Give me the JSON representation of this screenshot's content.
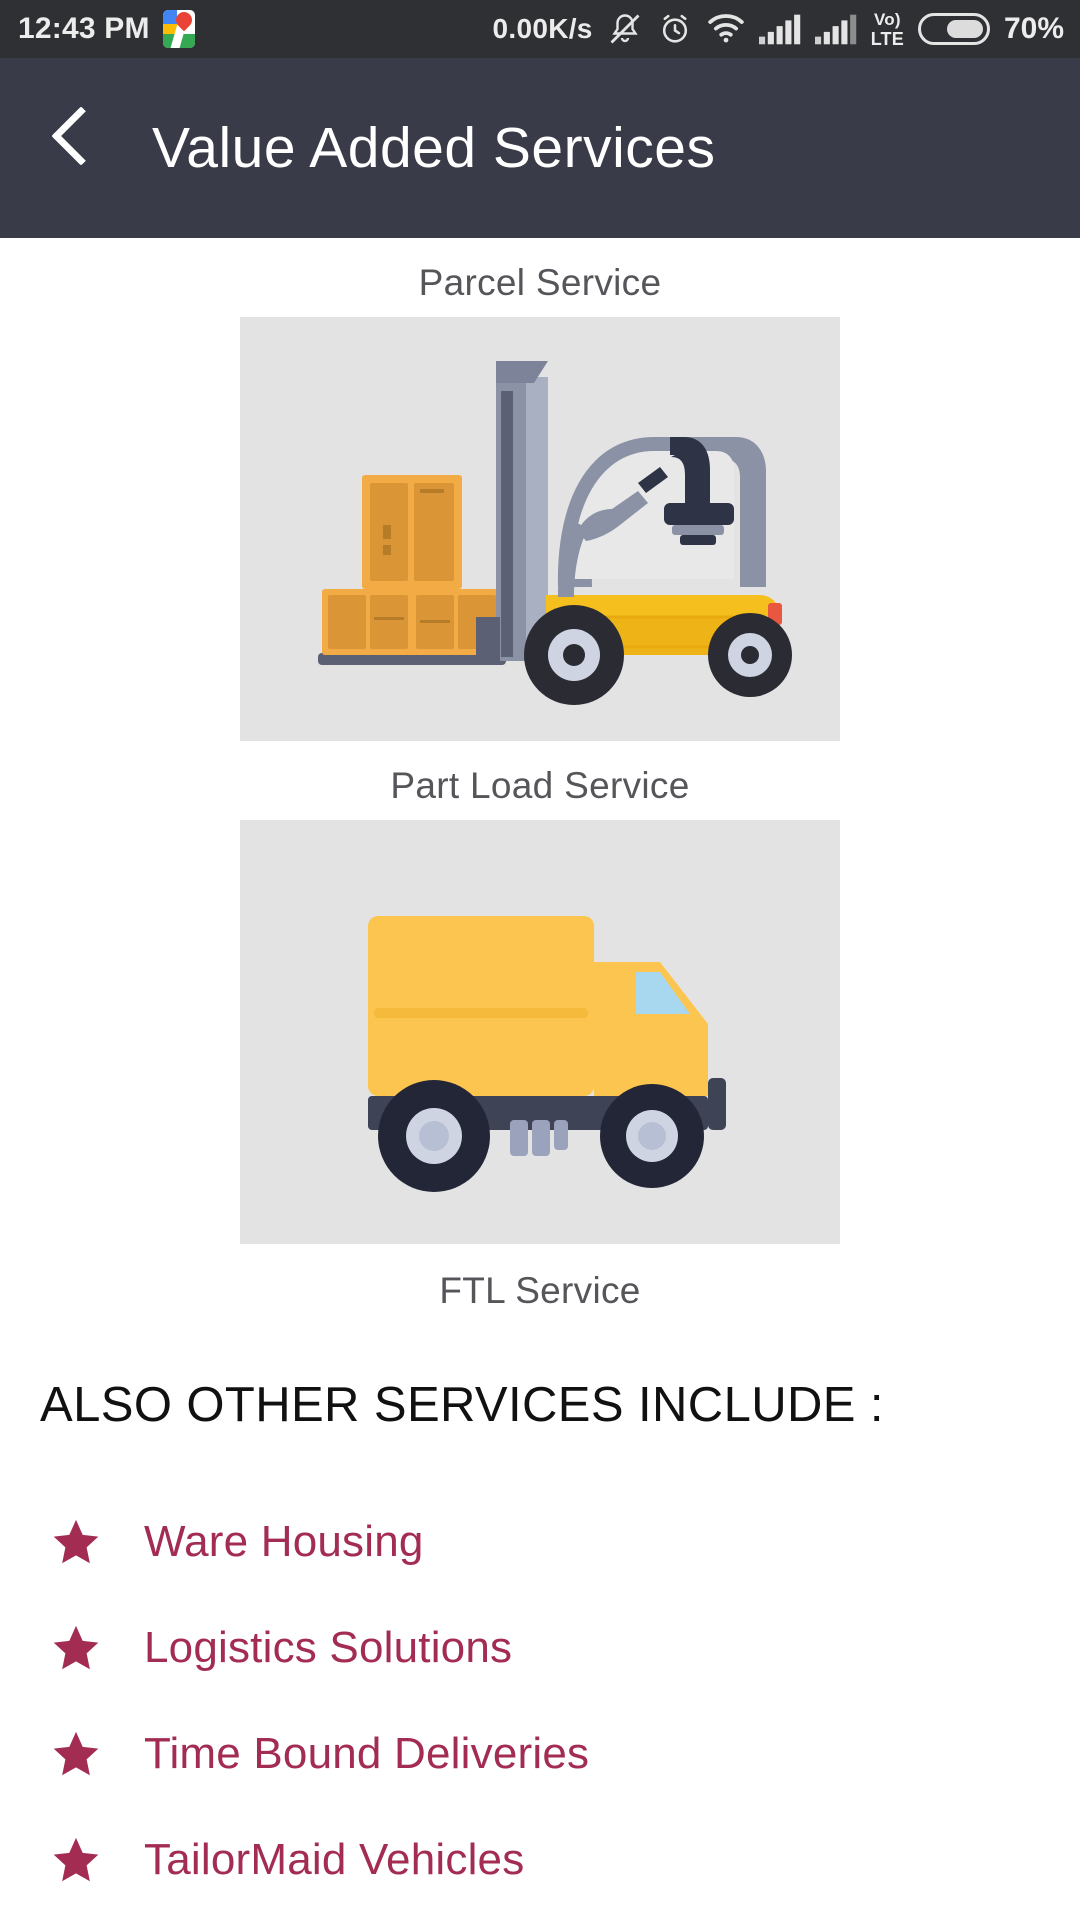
{
  "statusbar": {
    "time": "12:43 PM",
    "maps_icon": "google-maps-icon",
    "network_speed": "0.00K/s",
    "icons": [
      "mute-bell-icon",
      "alarm-clock-icon",
      "wifi-icon",
      "signal-bars-icon-1",
      "signal-bars-icon-2"
    ],
    "volte_top": "Vo)",
    "volte_bottom": "LTE",
    "battery_percent": "70%"
  },
  "header": {
    "back_label": "back-chevron",
    "title": "Value Added Services"
  },
  "services": [
    {
      "label": "Parcel Service",
      "image": "forklift-illustration"
    },
    {
      "label": "Part Load Service",
      "image": "delivery-truck-illustration"
    },
    {
      "label": "FTL Service",
      "image": null
    }
  ],
  "also_section": {
    "title": "ALSO OTHER SERVICES INCLUDE :",
    "items": [
      {
        "label": "Ware Housing"
      },
      {
        "label": "Logistics Solutions"
      },
      {
        "label": "Time Bound Deliveries"
      },
      {
        "label": "TailorMaid Vehicles"
      }
    ]
  },
  "colors": {
    "statusbar_bg": "#2f3033",
    "appbar_bg": "#3a3b48",
    "image_bg": "#e3e3e3",
    "label_text": "#55565a",
    "accent_maroon": "#a32c52",
    "truck_yellow": "#fcc köp"
  }
}
